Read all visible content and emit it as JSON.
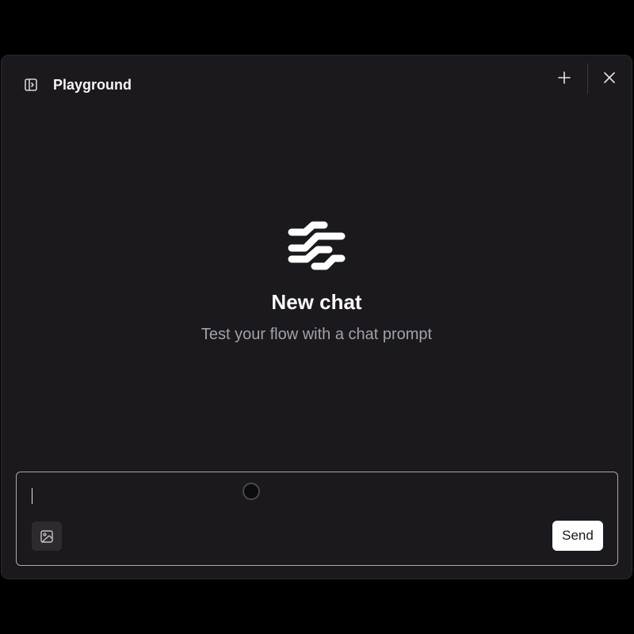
{
  "header": {
    "title": "Playground",
    "sidebar_toggle_icon": "panel-left-open-icon",
    "new_chat_icon": "plus-icon",
    "close_icon": "close-icon"
  },
  "empty_state": {
    "logo_icon": "langflow-logo-icon",
    "title": "New chat",
    "subtitle": "Test your flow with a chat prompt"
  },
  "composer": {
    "input_value": "",
    "input_placeholder": "",
    "image_button_icon": "image-icon",
    "send_label": "Send"
  },
  "colors": {
    "background": "#1b191d",
    "page": "#000000",
    "text_primary": "#fafafa",
    "text_secondary": "#a1a1aa",
    "send_button_bg": "#ffffff"
  }
}
